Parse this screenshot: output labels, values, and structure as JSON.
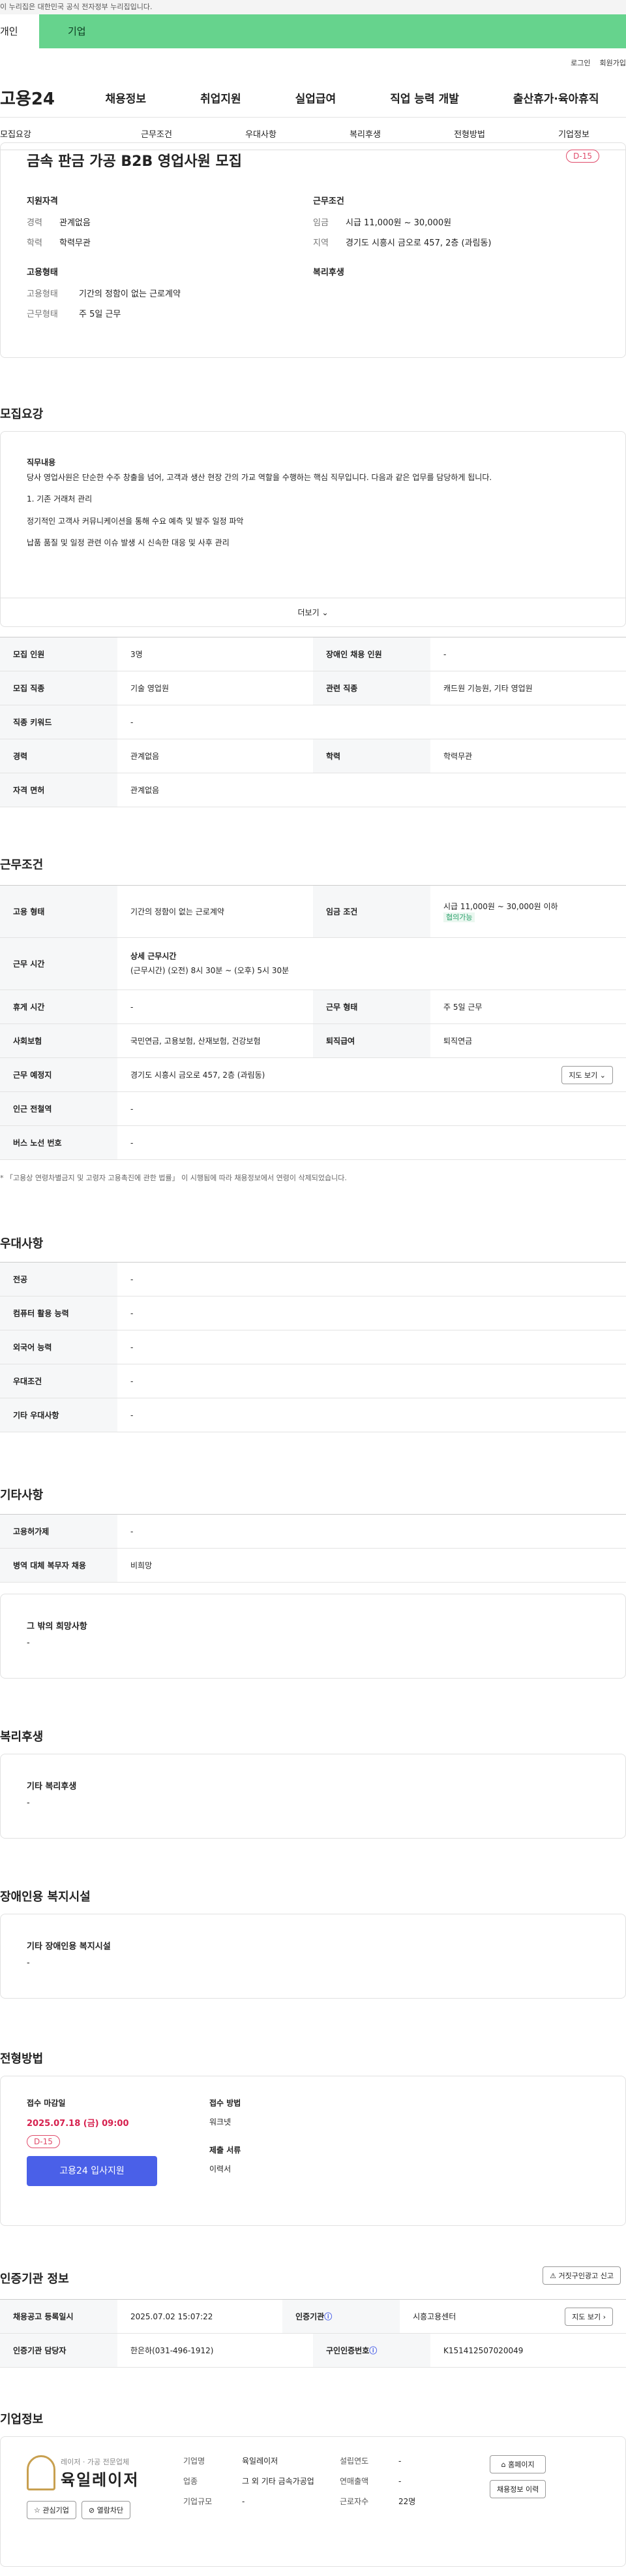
{
  "gov_notice": "이 누리집은 대한민국 공식 전자정부 누리집입니다.",
  "tabs": [
    "개인",
    "기업"
  ],
  "util": [
    "로그인",
    "회원가입"
  ],
  "logo": "고용24",
  "gnb": [
    "채용정보",
    "취업지원",
    "실업급여",
    "직업 능력 개발",
    "출산휴가·육아휴직"
  ],
  "anchors": [
    "모집요강",
    "근무조건",
    "우대사항",
    "복리후생",
    "전형방법",
    "기업정보"
  ],
  "title": "금속 판금 가공 B2B 영업사원 모집",
  "dday": "D-15",
  "summary": {
    "qual_title": "지원자격",
    "career_k": "경력",
    "career_v": "관계없음",
    "edu_k": "학력",
    "edu_v": "학력무관",
    "emp_title": "고용형태",
    "emp_k": "고용형태",
    "emp_v": "기간의 정함이 없는 근로계약",
    "work_k": "근무형태",
    "work_v": "주 5일 근무",
    "cond_title": "근무조건",
    "wage_k": "임금",
    "wage_v": "시급 11,000원 ~ 30,000원",
    "area_k": "지역",
    "area_v": "경기도 시흥시 금오로 457, 2층 (과림동)",
    "welfare_title": "복리후생"
  },
  "recruit": {
    "title": "모집요강",
    "job_label": "직무내용",
    "job_desc": "당사 영업사원은 단순한 수주 창출을 넘어, 고객과 생산 현장 간의 가교 역할을 수행하는 핵심 직무입니다. 다음과 같은 업무를 담당하게 됩니다.",
    "l1": "1. 기존 거래처 관리",
    "l2": "정기적인 고객사 커뮤니케이션을 통해 수요 예측 및 발주 일정 파악",
    "l3": "납품 품질 및 일정 관련 이슈 발생 시 신속한 대응 및 사후 관리",
    "more": "더보기"
  },
  "recruit_table": {
    "r1k": "모집 인원",
    "r1v": "3명",
    "r1k2": "장애인 채용 인원",
    "r1v2": "-",
    "r2k": "모집 직종",
    "r2v": "기술 영업원",
    "r2k2": "관련 직종",
    "r2v2": "캐드원 기능원, 기타 영업원",
    "r3k": "직종 키워드",
    "r3v": "-",
    "r4k": "경력",
    "r4v": "관계없음",
    "r4k2": "학력",
    "r4v2": "학력무관",
    "r5k": "자격 면허",
    "r5v": "관계없음"
  },
  "cond": {
    "title": "근무조건",
    "emp_k": "고용 형태",
    "emp_v": "기간의 정함이 없는 근로계약",
    "wage_k": "임금 조건",
    "wage_v": "시급 11,000원 ~ 30,000원 이하",
    "wage_badge": "협의가능",
    "time_k": "근무 시간",
    "time_sub": "상세 근무시간",
    "time_v": "(근무시간) (오전) 8시 30분 ~ (오후) 5시 30분",
    "rest_k": "휴게 시간",
    "rest_v": "-",
    "form_k": "근무 형태",
    "form_v": "주 5일 근무",
    "ins_k": "사회보험",
    "ins_v": "국민연금, 고용보험, 산재보험, 건강보험",
    "ret_k": "퇴직급여",
    "ret_v": "퇴직연금",
    "loc_k": "근무 예정지",
    "loc_v": "경기도 시흥시 금오로 457, 2층 (과림동)",
    "map": "지도 보기",
    "sub_k": "인근 전철역",
    "sub_v": "-",
    "bus_k": "버스 노선 번호",
    "bus_v": "-",
    "note": "* 「고용상 연령차별금지 및 고령자 고용촉진에 관한 법률」 이 시행됨에 따라 채용정보에서 연령이 삭제되었습니다."
  },
  "pref": {
    "title": "우대사항",
    "a": "전공",
    "b": "컴퓨터 활용 능력",
    "c": "외국어 능력",
    "d": "우대조건",
    "e": "기타 우대사항",
    "v": "-"
  },
  "etc": {
    "title": "기타사항",
    "a": "고용허가제",
    "av": "-",
    "b": "병역 대체 복무자 채용",
    "bv": "비희망",
    "c": "그 밖의 희망사항",
    "cv": "-"
  },
  "welfare": {
    "title": "복리후생",
    "label": "기타 복리후생",
    "v": "-"
  },
  "disab": {
    "title": "장애인용 복지시설",
    "label": "기타 장애인용 복지시설",
    "v": "-"
  },
  "proc": {
    "title": "전형방법",
    "deadline_k": "접수 마감일",
    "deadline_v": "2025.07.18 (금) 09:00",
    "dday": "D-15",
    "apply": "고용24 입사지원",
    "method_k": "접수 방법",
    "method_v": "워크넷",
    "docs_k": "제출 서류",
    "docs_v": "이력서"
  },
  "agency": {
    "title": "인증기관 정보",
    "report": "거짓구인광고 신고",
    "reg_k": "채용공고 등록일시",
    "reg_v": "2025.07.02 15:07:22",
    "ag_k": "인증기관",
    "ag_v": "시흥고용센터",
    "map": "지도 보기",
    "mgr_k": "인증기관 담당자",
    "mgr_v": "한은하(031-496-1912)",
    "no_k": "구인인증번호",
    "no_v": "K151412507020049"
  },
  "company": {
    "title": "기업정보",
    "logo_sub": "레이저 · 가공 전문업체",
    "logo_name": "육일레이저",
    "fav": "관심기업",
    "block": "열람차단",
    "name_k": "기업명",
    "name_v": "육일레이저",
    "biz_k": "업종",
    "biz_v": "그 외 기타 금속가공업",
    "size_k": "기업규모",
    "size_v": "-",
    "year_k": "설립연도",
    "year_v": "-",
    "sales_k": "연매출액",
    "sales_v": "-",
    "emp_k": "근로자수",
    "emp_v": "22명",
    "home": "홈페이지",
    "jobs": "채용정보 이력"
  }
}
